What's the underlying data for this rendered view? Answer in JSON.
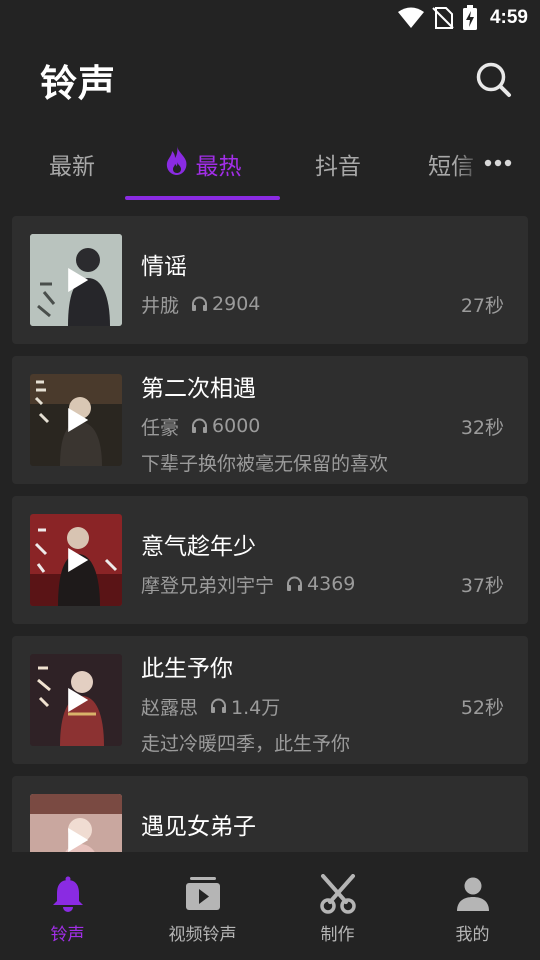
{
  "status_bar": {
    "time": "4:59"
  },
  "header": {
    "title": "铃声"
  },
  "tabs": [
    {
      "label": "最新",
      "active": false
    },
    {
      "label": "最热",
      "active": true,
      "icon": "flame-icon"
    },
    {
      "label": "抖音",
      "active": false
    },
    {
      "label": "短信",
      "active": false
    }
  ],
  "ringtones": [
    {
      "title": "情谣",
      "artist": "井胧",
      "plays": "2904",
      "duration": "27秒",
      "description": "",
      "thumb_colors": [
        "#c9d2cc",
        "#8f9a95"
      ]
    },
    {
      "title": "第二次相遇",
      "artist": "任豪",
      "plays": "6000",
      "duration": "32秒",
      "description": "下辈子换你被毫无保留的喜欢",
      "thumb_colors": [
        "#4a3a2c",
        "#20201c"
      ]
    },
    {
      "title": "意气趁年少",
      "artist": "摩登兄弟刘宇宁",
      "plays": "4369",
      "duration": "37秒",
      "description": "",
      "thumb_colors": [
        "#9a2a2a",
        "#5a1416"
      ]
    },
    {
      "title": "此生予你",
      "artist": "赵露思",
      "plays": "1.4万",
      "duration": "52秒",
      "description": "走过冷暖四季，此生予你",
      "thumb_colors": [
        "#3c2a2e",
        "#8a3a3a"
      ]
    },
    {
      "title": "遇见女弟子",
      "artist": "",
      "plays": "",
      "duration": "",
      "description": "",
      "thumb_colors": [
        "#d8b8b0",
        "#7a4a42"
      ]
    }
  ],
  "bottom_nav": [
    {
      "label": "铃声",
      "icon": "bell-icon",
      "active": true
    },
    {
      "label": "视频铃声",
      "icon": "video-play-icon",
      "active": false
    },
    {
      "label": "制作",
      "icon": "scissors-icon",
      "active": false
    },
    {
      "label": "我的",
      "icon": "person-icon",
      "active": false
    }
  ],
  "colors": {
    "accent": "#8a2be2",
    "background": "#232323",
    "card": "#2e2e2e",
    "secondary_text": "#9b9b9b"
  }
}
